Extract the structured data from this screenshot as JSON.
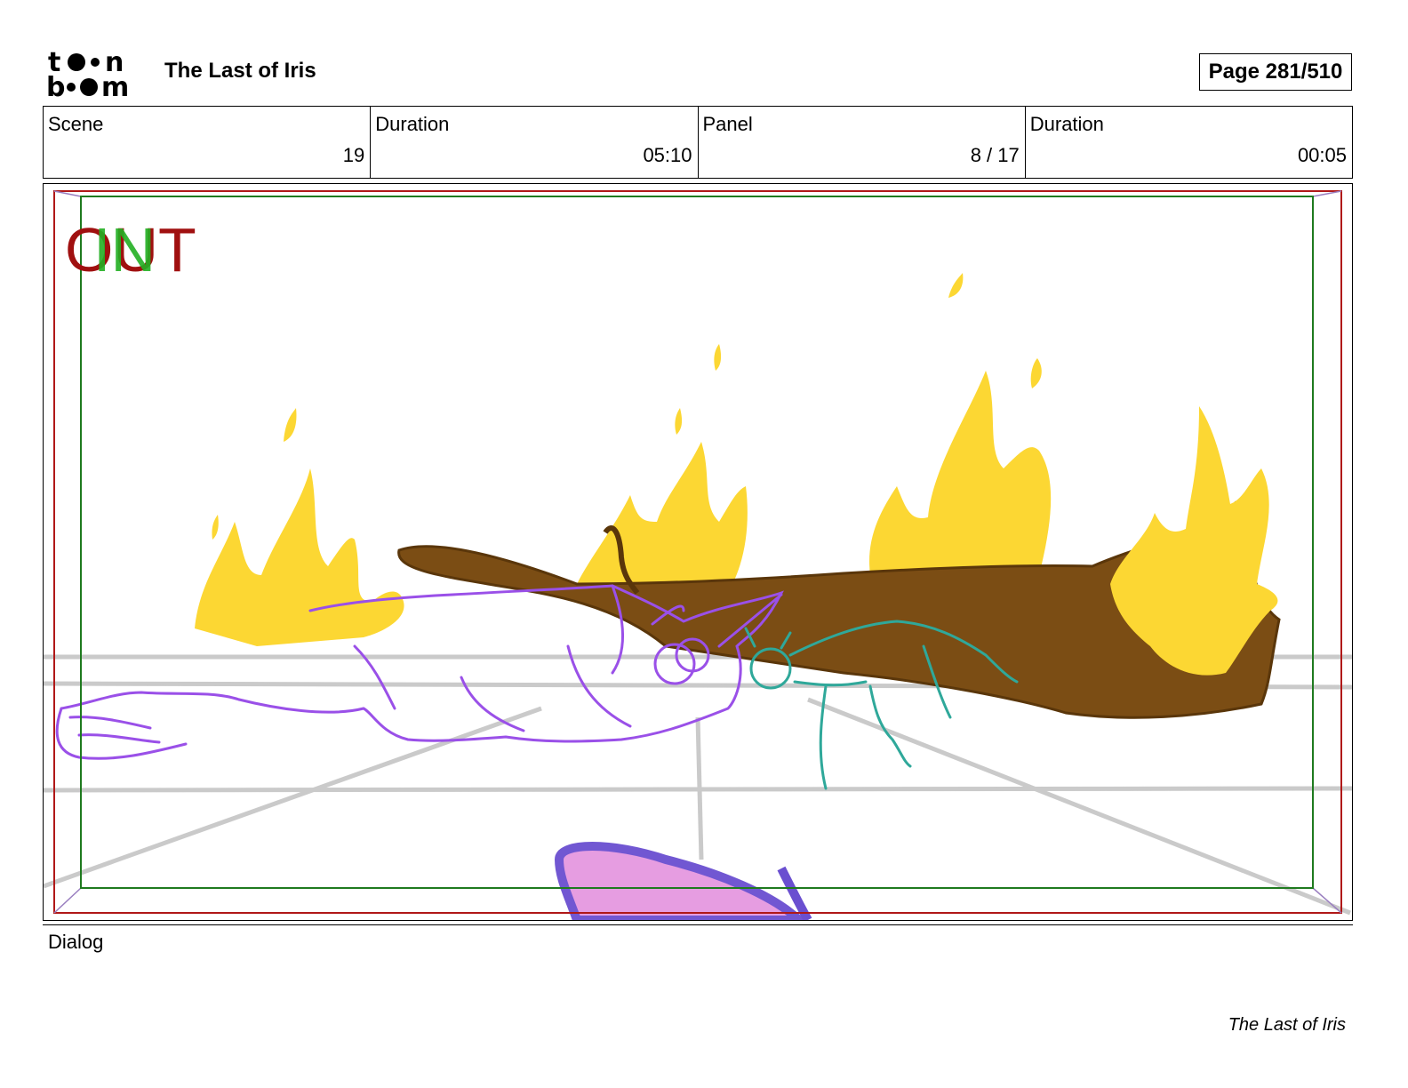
{
  "header": {
    "logo_text": "toon boom",
    "title": "The Last of Iris",
    "page": "Page 281/510"
  },
  "info": {
    "scene_label": "Scene",
    "scene_value": "19",
    "scene_duration_label": "Duration",
    "scene_duration_value": "05:10",
    "panel_label": "Panel",
    "panel_value": "8 / 17",
    "panel_duration_label": "Duration",
    "panel_duration_value": "00:05"
  },
  "panel": {
    "out_marker": "OUT",
    "in_marker": "IN",
    "colors": {
      "out_frame": "#b01818",
      "in_frame": "#1f7a1f",
      "fire": "#fcd733",
      "log": "#7b4d14",
      "unicorn": "#9a50e8",
      "creature": "#2fa89a",
      "saddle": "#e598e0"
    }
  },
  "dialog": {
    "label": "Dialog"
  },
  "footer": {
    "text": "The Last of Iris"
  }
}
